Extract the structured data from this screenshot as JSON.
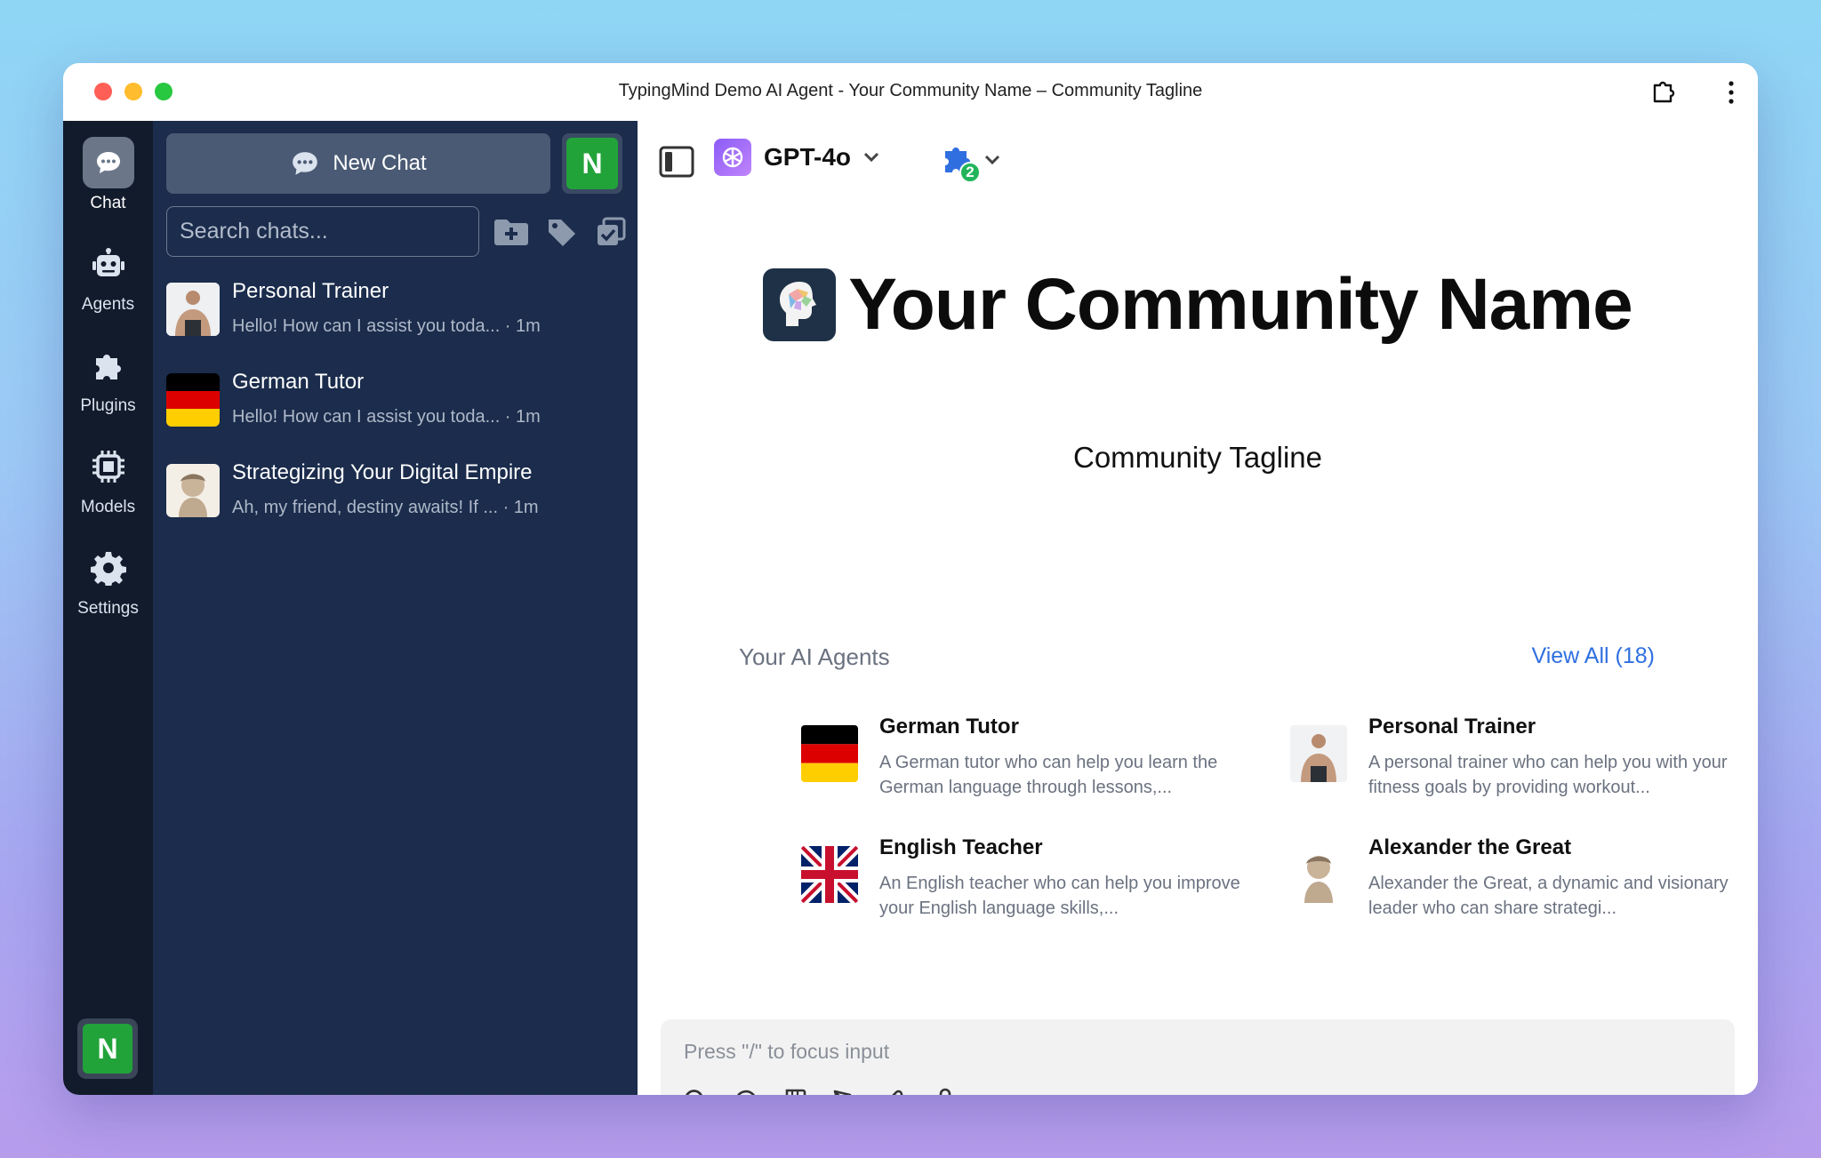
{
  "window": {
    "title": "TypingMind Demo AI Agent - Your Community Name – Community Tagline"
  },
  "rail": {
    "items": [
      {
        "label": "Chat",
        "icon": "chat-bubble-icon"
      },
      {
        "label": "Agents",
        "icon": "robot-icon"
      },
      {
        "label": "Plugins",
        "icon": "puzzle-icon"
      },
      {
        "label": "Models",
        "icon": "chip-icon"
      },
      {
        "label": "Settings",
        "icon": "gear-icon"
      }
    ],
    "avatar": "N"
  },
  "sidebar": {
    "new_chat_label": "New Chat",
    "avatar": "N",
    "search_placeholder": "Search chats...",
    "chats": [
      {
        "title": "Personal Trainer",
        "preview": "Hello! How can I assist you toda...",
        "time": "1m"
      },
      {
        "title": "German Tutor",
        "preview": "Hello! How can I assist you toda...",
        "time": "1m"
      },
      {
        "title": "Strategizing Your Digital Empire",
        "preview": "Ah, my friend, destiny awaits! If ...",
        "time": "1m"
      }
    ]
  },
  "header": {
    "model_name": "GPT-4o",
    "plugin_count": "2"
  },
  "hero": {
    "title": "Your Community Name",
    "tagline": "Community Tagline"
  },
  "agents": {
    "heading": "Your AI Agents",
    "view_all": "View All (18)",
    "items": [
      {
        "name": "German Tutor",
        "desc": "A German tutor who can help you learn the German language through lessons,..."
      },
      {
        "name": "Personal Trainer",
        "desc": "A personal trainer who can help you with your fitness goals by providing workout..."
      },
      {
        "name": "English Teacher",
        "desc": "An English teacher who can help you improve your English language skills,..."
      },
      {
        "name": "Alexander the Great",
        "desc": "Alexander the Great, a dynamic and visionary leader who can share strategi..."
      }
    ]
  },
  "composer": {
    "placeholder": "Press \"/\" to focus input"
  },
  "colors": {
    "rail_bg": "#111b2b",
    "sidebar_bg": "#1b2c4c",
    "accent_green": "#22a33a",
    "link_blue": "#2f6fe0"
  }
}
